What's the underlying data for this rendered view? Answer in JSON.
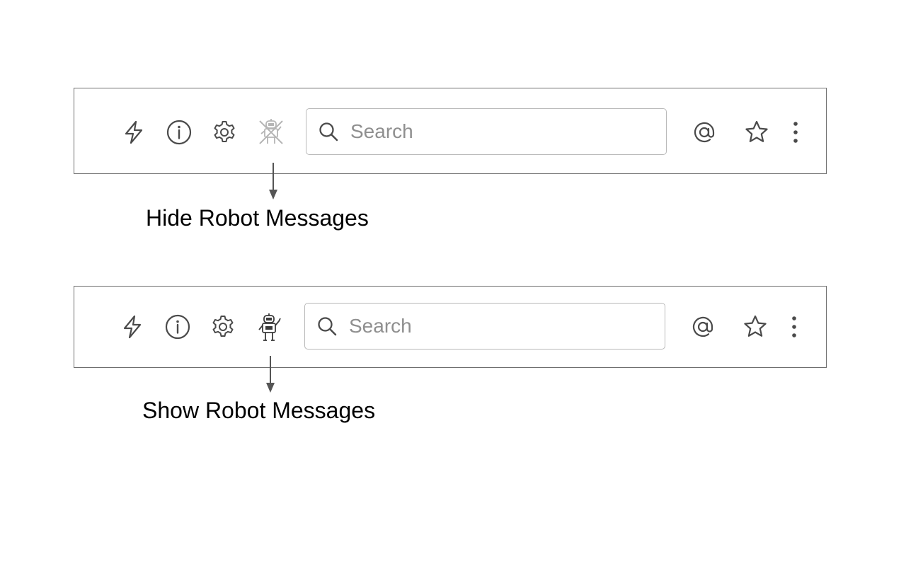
{
  "toolbars": [
    {
      "state": "robot messages hidden",
      "search_placeholder": "Search",
      "robot_icon": "robot-hidden-icon",
      "caption": "Hide Robot Messages"
    },
    {
      "state": "robot messages shown",
      "search_placeholder": "Search",
      "robot_icon": "robot-icon",
      "caption": "Show Robot Messages"
    }
  ],
  "icons": [
    "lightning-icon",
    "info-icon",
    "gear-icon",
    "search-icon",
    "at-mention-icon",
    "star-icon",
    "more-vertical-icon"
  ],
  "colors": {
    "icon_stroke": "#4a4a4a",
    "toolbar_border": "#6e6e6e",
    "search_border": "#b9b9b9",
    "placeholder": "#8f8f8f",
    "faded_icon": "#b5b5b5"
  }
}
